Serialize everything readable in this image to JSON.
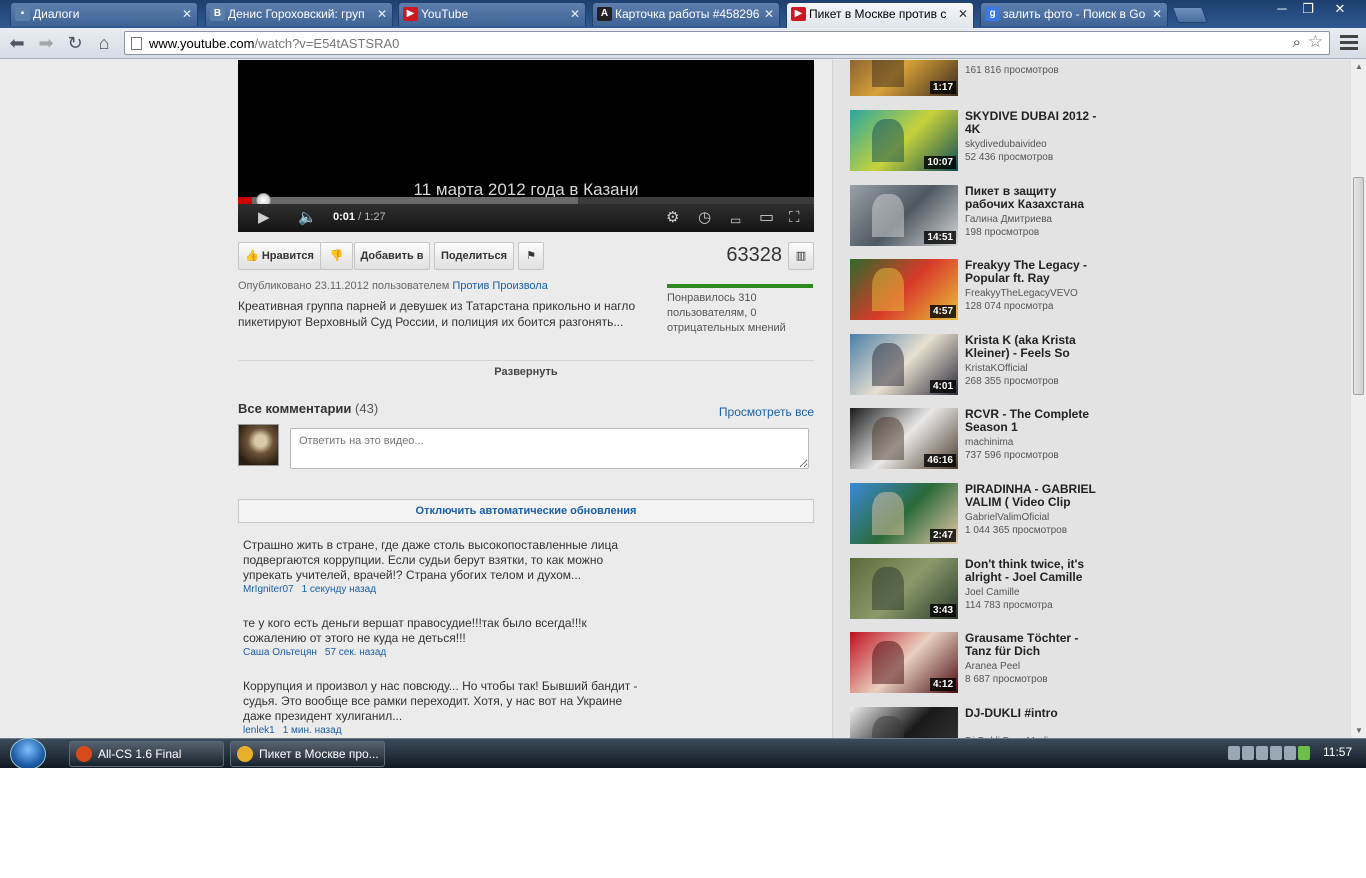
{
  "tabs": [
    {
      "label": "Диалоги",
      "favicon": "vk-chat-icon",
      "color": "#5b7fa8",
      "glyph": "▪",
      "active": false
    },
    {
      "label": "Денис Гороховский: груп",
      "favicon": "vk-icon",
      "color": "#5b7fa8",
      "glyph": "B",
      "active": false
    },
    {
      "label": "YouTube",
      "favicon": "youtube-icon",
      "color": "#cc181e",
      "glyph": "▶",
      "active": false
    },
    {
      "label": "Карточка работы #458296",
      "favicon": "a-icon",
      "color": "#222222",
      "glyph": "A",
      "active": false
    },
    {
      "label": "Пикет в Москве против с",
      "favicon": "youtube-icon",
      "color": "#cc181e",
      "glyph": "▶",
      "active": true
    },
    {
      "label": "залить фото - Поиск в Go",
      "favicon": "google-icon",
      "color": "#3b78e7",
      "glyph": "g",
      "active": false
    }
  ],
  "address": {
    "host": "www.youtube.com",
    "path": "/watch?v=E54tASTSRA0"
  },
  "player": {
    "subtitle": "11 марта 2012 года в Казани",
    "current_time": "0:01",
    "duration": "1:27",
    "played_fraction": 0.011,
    "buffered_fraction": 0.59
  },
  "actions": {
    "like": "Нравится",
    "add_to": "Добавить в",
    "share": "Поделиться"
  },
  "stats": {
    "views": "63328",
    "likes_text": "Понравилось 310 пользователям, 0 отрицательных мнений",
    "like_fraction": 1.0
  },
  "published": {
    "prefix": "Опубликовано 23.11.2012 пользователем",
    "channel": "Против Произвола"
  },
  "description": "Креативная группа парней и девушек из Татарстана прикольно и нагло пикетируют Верховный Суд России, и полиция их боится разгонять...",
  "expand_label": "Развернуть",
  "comments": {
    "title": "Все комментарии",
    "count": "(43)",
    "view_all": "Просмотреть все",
    "placeholder": "Ответить на это видео...",
    "live_toggle": "Отключить автоматические обновления",
    "items": [
      {
        "text": "Страшно жить в стране, где даже столь высокопоставленные лица подвергаются коррупции. Если судьи берут взятки, то как можно упрекать учителей, врачей!? Страна убогих телом и духом...",
        "author": "MrIgniter07",
        "time": "1 секунду назад"
      },
      {
        "text": "те у кого есть деньги вершат правосудие!!!так было всегда!!!к сожалению от этого не куда не деться!!!",
        "author": "Саша Ольтецян",
        "time": "57 сек. назад"
      },
      {
        "text": "Коррупция и произвол у нас повсюду... Но чтобы так! Бывший бандит - судья. Это вообще все рамки переходит. Хотя, у нас вот на Украине даже президент хулиганил...",
        "author": "lenlek1",
        "time": "1 мин. назад"
      }
    ]
  },
  "related": [
    {
      "title": "",
      "channel": "",
      "views": "161 816 просмотров",
      "duration": "1:17",
      "thumb": [
        "#6a4a2a",
        "#d9a23a",
        "#3a2a1a"
      ]
    },
    {
      "title": "SKYDIVE DUBAI 2012 - 4K",
      "channel": "skydivedubaivideo",
      "views": "52 436 просмотров",
      "duration": "10:07",
      "thumb": [
        "#2aa6a0",
        "#c7d23a",
        "#0e4c57"
      ]
    },
    {
      "title": "Пикет в защиту рабочих Казахстана",
      "channel": "Галина Дмитриева",
      "views": "198 просмотров",
      "duration": "14:51",
      "thumb": [
        "#9aa1a8",
        "#4e5861",
        "#d8d8d8"
      ]
    },
    {
      "title": "Freakyy The Legacy - Popular ft. Ray",
      "channel": "FreakyyTheLegacyVEVO",
      "views": "128 074 просмотра",
      "duration": "4:57",
      "thumb": [
        "#2f6a2a",
        "#d83a2a",
        "#e8c23a"
      ]
    },
    {
      "title": "Krista K (aka Krista Kleiner) - Feels So",
      "channel": "KristaKOfficial",
      "views": "268 355 просмотров",
      "duration": "4:01",
      "thumb": [
        "#4a7fa8",
        "#e8e0d0",
        "#2a2a3a"
      ]
    },
    {
      "title": "RCVR - The Complete Season 1",
      "channel": "machinima",
      "views": "737 596 просмотров",
      "duration": "46:16",
      "thumb": [
        "#1a1a1a",
        "#e8e8e8",
        "#4a3a2a"
      ]
    },
    {
      "title": "PIRADINHA - GABRIEL VALIM ( Video Clip",
      "channel": "GabrielValimOficial",
      "views": "1 044 365 просмотров",
      "duration": "2:47",
      "thumb": [
        "#3a8ad8",
        "#2a6a3a",
        "#e8c8a8"
      ]
    },
    {
      "title": "Don't think twice, it's alright - Joel Camille",
      "channel": "Joel Camille",
      "views": "114 783 просмотра",
      "duration": "3:43",
      "thumb": [
        "#5a6a3a",
        "#8a9a6a",
        "#2a3a2a"
      ]
    },
    {
      "title": "Grausame Töchter - Tanz für Dich",
      "channel": "Aranea Peel",
      "views": "8 687 просмотров",
      "duration": "4:12",
      "thumb": [
        "#c01020",
        "#e8d0c0",
        "#4a0a10"
      ]
    },
    {
      "title": "DJ-DUKLI #intro",
      "channel": "Dj-Dukli DuanMedia",
      "views": "",
      "duration": "",
      "thumb": [
        "#f0f0f0",
        "#1a1a1a",
        "#3a3a3a"
      ]
    }
  ],
  "taskbar": {
    "items": [
      {
        "label": "All-CS 1.6 Final",
        "icon": "cs-icon",
        "color": "#d84a1a"
      },
      {
        "label": "Пикет в Москве про...",
        "icon": "chrome-icon",
        "color": "#e8b02a"
      }
    ],
    "clock": "11:57"
  }
}
